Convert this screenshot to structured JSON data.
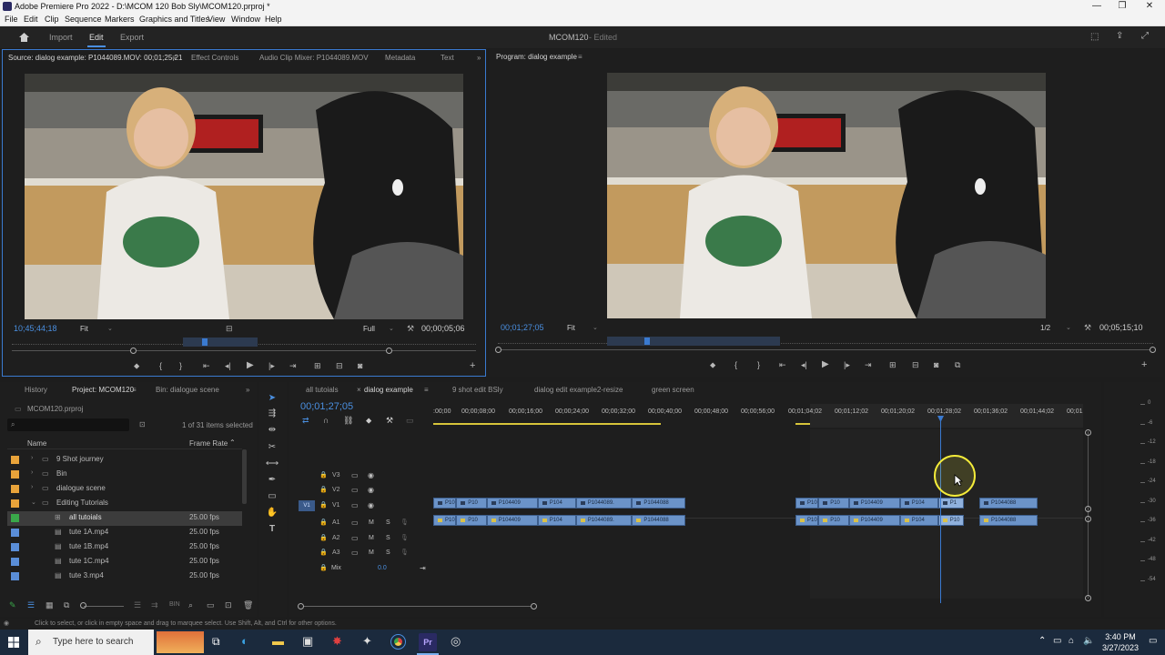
{
  "window": {
    "title": "Adobe Premiere Pro 2022 - D:\\MCOM 120 Bob Sly\\MCOM120.prproj *"
  },
  "menu": [
    "File",
    "Edit",
    "Clip",
    "Sequence",
    "Markers",
    "Graphics and Titles",
    "View",
    "Window",
    "Help"
  ],
  "workspace": {
    "tabs": [
      "Import",
      "Edit",
      "Export"
    ],
    "active": "Edit",
    "project_name": "MCOM120",
    "edited": "- Edited"
  },
  "source_panel": {
    "tabs": [
      "Source: dialog example: P1044089.MOV: 00;01;25;21",
      "Effect Controls",
      "Audio Clip Mixer: P1044089.MOV",
      "Metadata",
      "Text"
    ],
    "timecode": "10;45;44;18",
    "fit": "Fit",
    "resolution": "Full",
    "duration": "00;00;05;06"
  },
  "program_panel": {
    "tab": "Program: dialog example",
    "timecode": "00;01;27;05",
    "fit": "Fit",
    "resolution": "1/2",
    "duration": "00;05;15;10"
  },
  "project_panel": {
    "tabs": [
      "History",
      "Project: MCOM120",
      "Bin: dialogue scene"
    ],
    "project_file": "MCOM120.prproj",
    "selection_info": "1 of 31 items selected",
    "col_name": "Name",
    "col_framerate": "Frame Rate",
    "items": [
      {
        "name": "9 Shot journey",
        "rate": "",
        "color": "#e8a33a",
        "type": "folder",
        "indent": 0
      },
      {
        "name": "Bin",
        "rate": "",
        "color": "#e8a33a",
        "type": "folder",
        "indent": 0
      },
      {
        "name": "dialogue scene",
        "rate": "",
        "color": "#e8a33a",
        "type": "folder",
        "indent": 0
      },
      {
        "name": "Editing Tutorials",
        "rate": "",
        "color": "#e8a33a",
        "type": "folder",
        "indent": 0
      },
      {
        "name": "all tutoials",
        "rate": "25.00 fps",
        "color": "#3aa84a",
        "type": "seq",
        "indent": 1
      },
      {
        "name": "tute 1A.mp4",
        "rate": "25.00 fps",
        "color": "#5a8ed8",
        "type": "file",
        "indent": 1
      },
      {
        "name": "tute 1B.mp4",
        "rate": "25.00 fps",
        "color": "#5a8ed8",
        "type": "file",
        "indent": 1
      },
      {
        "name": "tute 1C.mp4",
        "rate": "25.00 fps",
        "color": "#5a8ed8",
        "type": "file",
        "indent": 1
      },
      {
        "name": "tute 3.mp4",
        "rate": "25.00 fps",
        "color": "#5a8ed8",
        "type": "file",
        "indent": 1
      }
    ]
  },
  "timeline": {
    "tabs": [
      "all tutoials",
      "dialog example",
      "9 shot edit BSly",
      "dialog edit example2-resize",
      "green screen"
    ],
    "active_tab": "dialog example",
    "timecode": "00;01;27;05",
    "ruler_left": [
      ":00;00",
      "00;00;08;00",
      "00;00;16;00",
      "00;00;24;00",
      "00;00;32;00",
      "00;00;40;00",
      "00;00;48;00",
      "00;00;56;00"
    ],
    "ruler_right": [
      "00;01;04;02",
      "00;01;12;02",
      "00;01;20;02",
      "00;01;28;02",
      "00;01;36;02",
      "00;01;44;02",
      "00;01"
    ],
    "tracks": [
      "V3",
      "V2",
      "V1",
      "A1",
      "A2",
      "A3"
    ],
    "mix_label": "Mix",
    "mix_value": "0.0",
    "clips_v1_left": [
      "P10",
      "P10",
      "P104409",
      "P104",
      "P1044089.",
      "P1044088"
    ],
    "clips_v1_right": [
      "P10",
      "P10",
      "P104409",
      "P104",
      "P1",
      "P1044088"
    ],
    "clips_a1_left": [
      "P10",
      "P10",
      "P104409",
      "P104",
      "P1044089.",
      "P1044088"
    ],
    "clips_a1_right": [
      "P10",
      "P10",
      "P104409",
      "P104",
      "P10",
      "P1044088"
    ]
  },
  "meter_labels": [
    "0",
    "-6",
    "-12",
    "-18",
    "-24",
    "-30",
    "-36",
    "-42",
    "-48",
    "-54"
  ],
  "status_text": "Click to select, or click in empty space and drag to marquee select. Use Shift, Alt, and Ctrl for other options.",
  "taskbar": {
    "search_placeholder": "Type here to search",
    "time": "3:40 PM",
    "date": "3/27/2023"
  }
}
